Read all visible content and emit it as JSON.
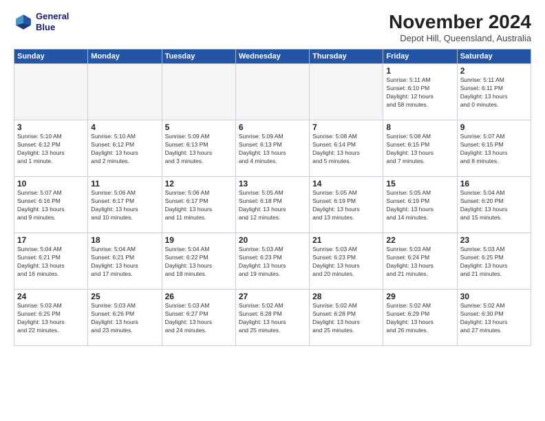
{
  "header": {
    "logo_line1": "General",
    "logo_line2": "Blue",
    "month": "November 2024",
    "location": "Depot Hill, Queensland, Australia"
  },
  "weekdays": [
    "Sunday",
    "Monday",
    "Tuesday",
    "Wednesday",
    "Thursday",
    "Friday",
    "Saturday"
  ],
  "weeks": [
    [
      {
        "day": "",
        "info": ""
      },
      {
        "day": "",
        "info": ""
      },
      {
        "day": "",
        "info": ""
      },
      {
        "day": "",
        "info": ""
      },
      {
        "day": "",
        "info": ""
      },
      {
        "day": "1",
        "info": "Sunrise: 5:11 AM\nSunset: 6:10 PM\nDaylight: 12 hours\nand 58 minutes."
      },
      {
        "day": "2",
        "info": "Sunrise: 5:11 AM\nSunset: 6:11 PM\nDaylight: 13 hours\nand 0 minutes."
      }
    ],
    [
      {
        "day": "3",
        "info": "Sunrise: 5:10 AM\nSunset: 6:12 PM\nDaylight: 13 hours\nand 1 minute."
      },
      {
        "day": "4",
        "info": "Sunrise: 5:10 AM\nSunset: 6:12 PM\nDaylight: 13 hours\nand 2 minutes."
      },
      {
        "day": "5",
        "info": "Sunrise: 5:09 AM\nSunset: 6:13 PM\nDaylight: 13 hours\nand 3 minutes."
      },
      {
        "day": "6",
        "info": "Sunrise: 5:09 AM\nSunset: 6:13 PM\nDaylight: 13 hours\nand 4 minutes."
      },
      {
        "day": "7",
        "info": "Sunrise: 5:08 AM\nSunset: 6:14 PM\nDaylight: 13 hours\nand 5 minutes."
      },
      {
        "day": "8",
        "info": "Sunrise: 5:08 AM\nSunset: 6:15 PM\nDaylight: 13 hours\nand 7 minutes."
      },
      {
        "day": "9",
        "info": "Sunrise: 5:07 AM\nSunset: 6:15 PM\nDaylight: 13 hours\nand 8 minutes."
      }
    ],
    [
      {
        "day": "10",
        "info": "Sunrise: 5:07 AM\nSunset: 6:16 PM\nDaylight: 13 hours\nand 9 minutes."
      },
      {
        "day": "11",
        "info": "Sunrise: 5:06 AM\nSunset: 6:17 PM\nDaylight: 13 hours\nand 10 minutes."
      },
      {
        "day": "12",
        "info": "Sunrise: 5:06 AM\nSunset: 6:17 PM\nDaylight: 13 hours\nand 11 minutes."
      },
      {
        "day": "13",
        "info": "Sunrise: 5:05 AM\nSunset: 6:18 PM\nDaylight: 13 hours\nand 12 minutes."
      },
      {
        "day": "14",
        "info": "Sunrise: 5:05 AM\nSunset: 6:19 PM\nDaylight: 13 hours\nand 13 minutes."
      },
      {
        "day": "15",
        "info": "Sunrise: 5:05 AM\nSunset: 6:19 PM\nDaylight: 13 hours\nand 14 minutes."
      },
      {
        "day": "16",
        "info": "Sunrise: 5:04 AM\nSunset: 6:20 PM\nDaylight: 13 hours\nand 15 minutes."
      }
    ],
    [
      {
        "day": "17",
        "info": "Sunrise: 5:04 AM\nSunset: 6:21 PM\nDaylight: 13 hours\nand 16 minutes."
      },
      {
        "day": "18",
        "info": "Sunrise: 5:04 AM\nSunset: 6:21 PM\nDaylight: 13 hours\nand 17 minutes."
      },
      {
        "day": "19",
        "info": "Sunrise: 5:04 AM\nSunset: 6:22 PM\nDaylight: 13 hours\nand 18 minutes."
      },
      {
        "day": "20",
        "info": "Sunrise: 5:03 AM\nSunset: 6:23 PM\nDaylight: 13 hours\nand 19 minutes."
      },
      {
        "day": "21",
        "info": "Sunrise: 5:03 AM\nSunset: 6:23 PM\nDaylight: 13 hours\nand 20 minutes."
      },
      {
        "day": "22",
        "info": "Sunrise: 5:03 AM\nSunset: 6:24 PM\nDaylight: 13 hours\nand 21 minutes."
      },
      {
        "day": "23",
        "info": "Sunrise: 5:03 AM\nSunset: 6:25 PM\nDaylight: 13 hours\nand 21 minutes."
      }
    ],
    [
      {
        "day": "24",
        "info": "Sunrise: 5:03 AM\nSunset: 6:25 PM\nDaylight: 13 hours\nand 22 minutes."
      },
      {
        "day": "25",
        "info": "Sunrise: 5:03 AM\nSunset: 6:26 PM\nDaylight: 13 hours\nand 23 minutes."
      },
      {
        "day": "26",
        "info": "Sunrise: 5:03 AM\nSunset: 6:27 PM\nDaylight: 13 hours\nand 24 minutes."
      },
      {
        "day": "27",
        "info": "Sunrise: 5:02 AM\nSunset: 6:28 PM\nDaylight: 13 hours\nand 25 minutes."
      },
      {
        "day": "28",
        "info": "Sunrise: 5:02 AM\nSunset: 6:28 PM\nDaylight: 13 hours\nand 25 minutes."
      },
      {
        "day": "29",
        "info": "Sunrise: 5:02 AM\nSunset: 6:29 PM\nDaylight: 13 hours\nand 26 minutes."
      },
      {
        "day": "30",
        "info": "Sunrise: 5:02 AM\nSunset: 6:30 PM\nDaylight: 13 hours\nand 27 minutes."
      }
    ]
  ]
}
